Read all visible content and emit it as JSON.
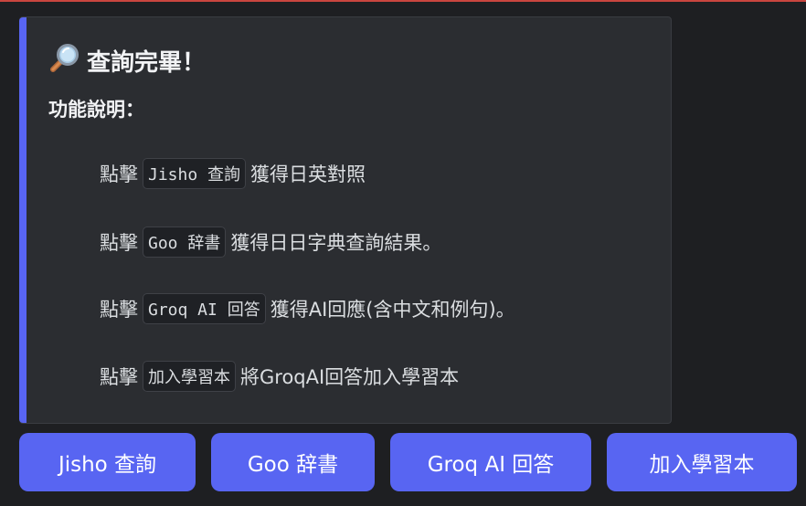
{
  "colors": {
    "background": "#1e1f22",
    "embed_background": "#2b2d31",
    "accent": "#5865f2",
    "button": "#5865f2",
    "top_bar": "#c9453f"
  },
  "embed": {
    "icon": "magnifying-glass-icon",
    "title": "查詢完畢！",
    "subheading": "功能說明：",
    "instructions": [
      {
        "prefix": "點擊",
        "code": "Jisho 查詢",
        "suffix": "獲得日英對照"
      },
      {
        "prefix": "點擊",
        "code": "Goo 辞書",
        "suffix": "獲得日日字典查詢結果。"
      },
      {
        "prefix": "點擊",
        "code": "Groq AI 回答",
        "suffix": "獲得AI回應(含中文和例句)。"
      },
      {
        "prefix": "點擊",
        "code": "加入學習本",
        "suffix": "將GroqAI回答加入學習本"
      }
    ]
  },
  "buttons": [
    {
      "label": "Jisho 查詢"
    },
    {
      "label": "Goo 辞書"
    },
    {
      "label": "Groq AI 回答"
    },
    {
      "label": "加入學習本"
    }
  ]
}
